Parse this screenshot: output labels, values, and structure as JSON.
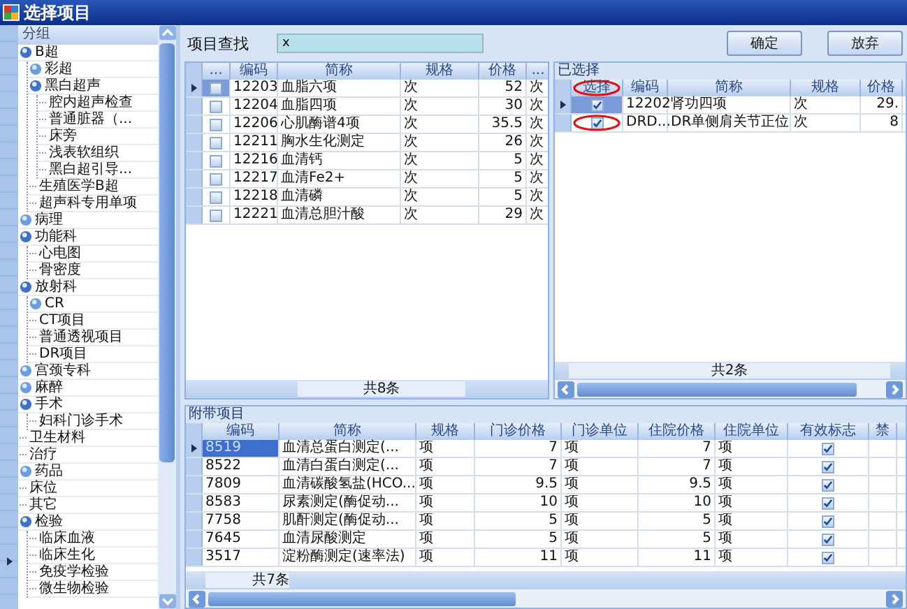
{
  "window": {
    "title": "选择项目"
  },
  "tree": {
    "header": "分组",
    "items": [
      {
        "label": "B超",
        "kind": "group",
        "expanded": true,
        "children": [
          {
            "label": "彩超",
            "kind": "group",
            "expanded": false
          },
          {
            "label": "黑白超声",
            "kind": "group",
            "expanded": true,
            "children": [
              {
                "label": "腔内超声检查",
                "kind": "leaf"
              },
              {
                "label": "普通脏器（...",
                "kind": "leaf"
              },
              {
                "label": "床旁",
                "kind": "leaf"
              },
              {
                "label": "浅表软组织",
                "kind": "leaf"
              },
              {
                "label": "黑白超引导...",
                "kind": "leaf"
              }
            ]
          },
          {
            "label": "生殖医学B超",
            "kind": "leaf"
          },
          {
            "label": "超声科专用单项",
            "kind": "leaf"
          }
        ]
      },
      {
        "label": "病理",
        "kind": "group",
        "expanded": false
      },
      {
        "label": "功能科",
        "kind": "group",
        "expanded": true,
        "children": [
          {
            "label": "心电图",
            "kind": "leaf"
          },
          {
            "label": "骨密度",
            "kind": "leaf"
          }
        ]
      },
      {
        "label": "放射科",
        "kind": "group",
        "expanded": true,
        "children": [
          {
            "label": "CR",
            "kind": "group",
            "expanded": false
          },
          {
            "label": "CT项目",
            "kind": "leaf"
          },
          {
            "label": "普通透视项目",
            "kind": "leaf"
          },
          {
            "label": "DR项目",
            "kind": "leaf"
          }
        ]
      },
      {
        "label": "宫颈专科",
        "kind": "group",
        "expanded": false
      },
      {
        "label": "麻醉",
        "kind": "group",
        "expanded": false
      },
      {
        "label": "手术",
        "kind": "group",
        "expanded": true,
        "children": [
          {
            "label": "妇科门诊手术",
            "kind": "leaf"
          }
        ]
      },
      {
        "label": "卫生材料",
        "kind": "leaf"
      },
      {
        "label": "治疗",
        "kind": "leaf"
      },
      {
        "label": "药品",
        "kind": "group",
        "expanded": false
      },
      {
        "label": "床位",
        "kind": "leaf"
      },
      {
        "label": "其它",
        "kind": "leaf"
      },
      {
        "label": "检验",
        "kind": "group",
        "expanded": true,
        "children": [
          {
            "label": "临床血液",
            "kind": "leaf"
          },
          {
            "label": "临床生化",
            "kind": "leaf"
          },
          {
            "label": "免疫学检验",
            "kind": "leaf"
          },
          {
            "label": "微生物检验",
            "kind": "leaf"
          }
        ]
      }
    ]
  },
  "search": {
    "label": "项目查找",
    "value": "x"
  },
  "buttons": [
    "确定",
    "放弃"
  ],
  "item_table": {
    "columns": [
      "...",
      "编码",
      "简称",
      "规格",
      "价格",
      "..."
    ],
    "rows": [
      {
        "current": true,
        "checked": false,
        "cells": [
          "",
          "12203",
          "血脂六项",
          "次",
          "52",
          "次"
        ]
      },
      {
        "current": false,
        "checked": false,
        "cells": [
          "",
          "12204",
          "血脂四项",
          "次",
          "30",
          "次"
        ]
      },
      {
        "current": false,
        "checked": false,
        "cells": [
          "",
          "12206",
          "心肌酶谱4项",
          "次",
          "35.5",
          "次"
        ]
      },
      {
        "current": false,
        "checked": false,
        "cells": [
          "",
          "12211",
          "胸水生化测定",
          "次",
          "26",
          "次"
        ]
      },
      {
        "current": false,
        "checked": false,
        "cells": [
          "",
          "12216",
          "血清钙",
          "次",
          "5",
          "次"
        ]
      },
      {
        "current": false,
        "checked": false,
        "cells": [
          "",
          "12217",
          "血清Fe2+",
          "次",
          "5",
          "次"
        ]
      },
      {
        "current": false,
        "checked": false,
        "cells": [
          "",
          "12218",
          "血清磷",
          "次",
          "5",
          "次"
        ]
      },
      {
        "current": false,
        "checked": false,
        "cells": [
          "",
          "12221",
          "血清总胆汁酸",
          "次",
          "29",
          "次"
        ]
      }
    ],
    "footer": "共8条"
  },
  "selected_table": {
    "title": "已选择",
    "columns": [
      "选择",
      "编码",
      "简称",
      "规格",
      "价格"
    ],
    "rows": [
      {
        "current": true,
        "checked": true,
        "cells": [
          "",
          "12202",
          "肾功四项",
          "次",
          "29."
        ]
      },
      {
        "current": false,
        "checked": true,
        "cells": [
          "",
          "DRD...",
          "DR单侧肩关节正位",
          "次",
          "8"
        ]
      }
    ],
    "footer": "共2条"
  },
  "attached_table": {
    "title": "附带项目",
    "columns": [
      "编码",
      "简称",
      "规格",
      "门诊价格",
      "门诊单位",
      "住院价格",
      "住院单位",
      "有效标志",
      "禁"
    ],
    "rows": [
      {
        "current": true,
        "valid": true,
        "cells": [
          "8519",
          "血清总蛋白测定(...",
          "项",
          "7",
          "项",
          "7",
          "项"
        ]
      },
      {
        "current": false,
        "valid": true,
        "cells": [
          "8522",
          "血清白蛋白测定(...",
          "项",
          "7",
          "项",
          "7",
          "项"
        ]
      },
      {
        "current": false,
        "valid": true,
        "cells": [
          "7809",
          "血清碳酸氢盐(HCO...",
          "项",
          "9.5",
          "项",
          "9.5",
          "项"
        ]
      },
      {
        "current": false,
        "valid": true,
        "cells": [
          "8583",
          "尿素测定(酶促动...",
          "项",
          "10",
          "项",
          "10",
          "项"
        ]
      },
      {
        "current": false,
        "valid": true,
        "cells": [
          "7758",
          "肌酐测定(酶促动...",
          "项",
          "5",
          "项",
          "5",
          "项"
        ]
      },
      {
        "current": false,
        "valid": true,
        "cells": [
          "7645",
          "血清尿酸测定",
          "项",
          "5",
          "项",
          "5",
          "项"
        ]
      },
      {
        "current": false,
        "valid": true,
        "cells": [
          "3517",
          "淀粉酶测定(速率法)",
          "项",
          "11",
          "项",
          "11",
          "项"
        ]
      }
    ],
    "footer": "共7条"
  }
}
